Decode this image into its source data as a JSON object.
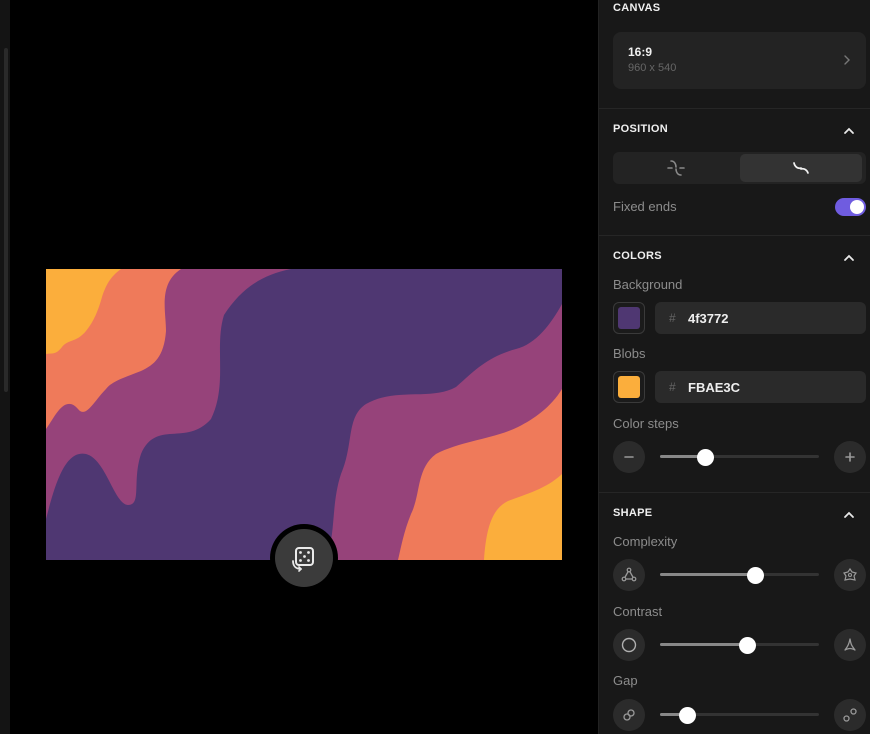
{
  "canvas": {
    "section_title": "CANVAS",
    "ratio": "16:9",
    "size": "960 x 540"
  },
  "position": {
    "section_title": "POSITION",
    "fixed_ends_label": "Fixed ends",
    "fixed_ends_on": true
  },
  "colors": {
    "section_title": "COLORS",
    "background_label": "Background",
    "background_hex": "4f3772",
    "background_color": "#4f3772",
    "blobs_label": "Blobs",
    "blobs_hex": "FBAE3C",
    "blobs_color": "#FBAE3C",
    "hash": "#",
    "color_steps_label": "Color steps",
    "color_steps_level": 0.28
  },
  "shape": {
    "section_title": "SHAPE",
    "complexity_label": "Complexity",
    "complexity_level": 0.6,
    "contrast_label": "Contrast",
    "contrast_level": 0.55,
    "gap_label": "Gap",
    "gap_level": 0.17
  },
  "palette": {
    "accent": "#6f5ce0",
    "wave_colors": [
      "#4f3772",
      "#96437a",
      "#ef7a5a",
      "#fbae3c"
    ]
  },
  "icons": {
    "dice": "dice-icon",
    "canvas_arrow": "chevron-right-icon",
    "collapse": "chevron-up-icon"
  }
}
